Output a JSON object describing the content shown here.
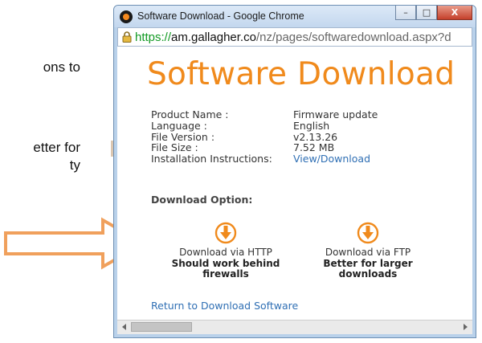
{
  "background_doc": {
    "line1": "ons to",
    "line2": "etter for",
    "line3": "ty"
  },
  "window": {
    "title": "Software Download - Google Chrome",
    "buttons": {
      "minimize": "–",
      "maximize": "□",
      "close": "X"
    }
  },
  "address_bar": {
    "scheme": "https://",
    "host": "am.gallagher.co",
    "path": "/nz/pages/softwaredownload.aspx?d"
  },
  "page": {
    "title": "Software Download",
    "info": {
      "product_name_label": "Product Name :",
      "language_label": "Language :",
      "file_version_label": "File Version :",
      "file_size_label": "File Size :",
      "installation_label": "Installation Instructions:",
      "product_name": "Firmware update",
      "language": "English",
      "file_version": "v2.13.26",
      "file_size": "7.52 MB",
      "installation_link": "View/Download"
    },
    "download_option_heading": "Download Option:",
    "http": {
      "label": "Download via HTTP",
      "note": "Should work behind firewalls"
    },
    "ftp": {
      "label": "Download via FTP",
      "note_line1": "Better for larger",
      "note_line2": "downloads"
    },
    "return_link": "Return to Download Software"
  },
  "colors": {
    "accent_orange": "#f08a1c",
    "link_blue": "#2f6fb4",
    "secure_green": "#129a24"
  },
  "icons": [
    "chrome-icon",
    "lock-icon",
    "download-icon",
    "arrow-right-icon"
  ]
}
